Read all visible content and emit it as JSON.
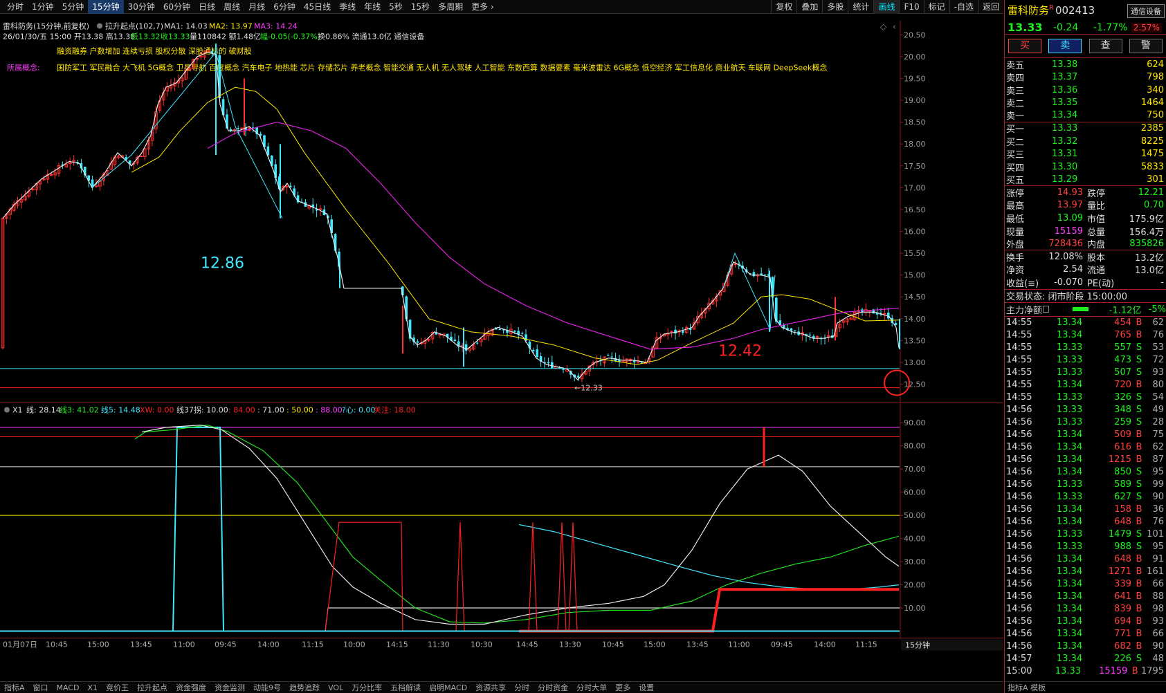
{
  "periods": [
    "分时",
    "1分钟",
    "5分钟",
    "15分钟",
    "30分钟",
    "60分钟",
    "日线",
    "周线",
    "月线",
    "6分钟",
    "45日线",
    "季线",
    "年线",
    "5秒",
    "15秒",
    "多周期",
    "更多 ›"
  ],
  "active_period": "15分钟",
  "tools": [
    "复权",
    "叠加",
    "多股",
    "统计",
    "画线",
    "F10",
    "标记",
    "-自选",
    "返回"
  ],
  "active_tool": "画线",
  "header": {
    "title": "雷科防务(15分钟,前复权)",
    "indicator": "拉升起点(102,7)",
    "ma1": "MA1: 14.03",
    "ma2": "MA2: 13.97",
    "ma3": "MA3: 14.24",
    "ohlc": "26/01/30/五 15:00 开13.38 高13.38",
    "low": "低13.32",
    "close": "收13.33",
    "vol": "量110842 额1.48亿",
    "amp": "幅-0.05(-0.37%)",
    "turn": "换0.86% 流通13.0亿 通信设备"
  },
  "tags": "融资融券  户数增加  连续亏损  股权分散  深股通标的  破财股",
  "concepts_label": "所属概念:",
  "concepts": "国防军工  军民融合  大飞机  5G概念  卫星导航  百度概念  汽车电子  地热能  芯片  存储芯片  养老概念  智能交通  无人机  无人驾驶  人工智能  东数西算  数据要素  毫米波雷达  6G概念  低空经济  军工信息化  商业航天  车联网  DeepSeek概念",
  "annotations": {
    "high_label": "12.86",
    "low_label": "12.42",
    "min_label": "←12.33"
  },
  "price_axis": [
    "20.50",
    "20.00",
    "19.50",
    "19.00",
    "18.50",
    "18.00",
    "17.50",
    "17.00",
    "16.50",
    "16.00",
    "15.50",
    "15.00",
    "14.50",
    "14.00",
    "13.50",
    "13.00",
    "12.50"
  ],
  "sub": {
    "name": "X1",
    "line": "线: 28.14",
    "l3": "线3: 41.02",
    "l5": "线5: 14.48",
    "xw": "XW: 0.00",
    "l37": "线37拐: 10.00",
    "v84": ": 84.00",
    "v71": ": 71.00",
    "v50": ": 50.00",
    "v88": ": 88.00",
    "heart": "?心: 0.00",
    "focus": "关注: 18.00",
    "axis": [
      "90.00",
      "80.00",
      "70.00",
      "60.00",
      "50.00",
      "40.00",
      "30.00",
      "20.00",
      "10.00"
    ]
  },
  "time_axis": [
    "01月07日",
    "10:45",
    "15:00",
    "13:45",
    "11:00",
    "09:45",
    "14:00",
    "11:15",
    "10:00",
    "14:15",
    "11:30",
    "10:30",
    "14:45",
    "13:30",
    "10:45",
    "15:00",
    "13:45",
    "11:00",
    "09:45",
    "14:00",
    "11:15"
  ],
  "period_badge": "15分钟",
  "bottom_tabs": [
    "指标A",
    "窗口",
    "MACD",
    "X1",
    "竞价王",
    "拉升起点",
    "资金强度",
    "资金监测",
    "动能9号",
    "趋势追踪",
    "VOL",
    "万分比率",
    "五档解读",
    "启明MACD",
    "资源共享",
    "分时",
    "分时资金",
    "分时大单",
    "更多",
    "设置"
  ],
  "quote": {
    "name": "雷科防务",
    "code": "002413",
    "flag": "R",
    "sector": "通信设备",
    "price": "13.33",
    "change": "-0.24",
    "pct": "-1.77%",
    "volratio": "2.57%",
    "buttons": [
      "买",
      "卖",
      "查",
      "警"
    ],
    "asks": [
      {
        "label": "卖五",
        "price": "13.38",
        "vol": "624"
      },
      {
        "label": "卖四",
        "price": "13.37",
        "vol": "798"
      },
      {
        "label": "卖三",
        "price": "13.36",
        "vol": "340"
      },
      {
        "label": "卖二",
        "price": "13.35",
        "vol": "1464"
      },
      {
        "label": "卖一",
        "price": "13.34",
        "vol": "750"
      }
    ],
    "bids": [
      {
        "label": "买一",
        "price": "13.33",
        "vol": "2385"
      },
      {
        "label": "买二",
        "price": "13.32",
        "vol": "8225"
      },
      {
        "label": "买三",
        "price": "13.31",
        "vol": "1475"
      },
      {
        "label": "买四",
        "price": "13.30",
        "vol": "5833"
      },
      {
        "label": "买五",
        "price": "13.29",
        "vol": "301"
      }
    ],
    "stats1": [
      {
        "k": "涨停",
        "v": "14.93",
        "vc": "red",
        "k2": "跌停",
        "v2": "12.21",
        "v2c": "green"
      },
      {
        "k": "最高",
        "v": "13.97",
        "vc": "red",
        "k2": "量比",
        "v2": "0.70",
        "v2c": "green"
      },
      {
        "k": "最低",
        "v": "13.09",
        "vc": "green",
        "k2": "市值",
        "v2": "175.9亿",
        "v2c": "white"
      },
      {
        "k": "现量",
        "v": "15159",
        "vc": "mag",
        "k2": "总量",
        "v2": "156.4万",
        "v2c": "white"
      },
      {
        "k": "外盘",
        "v": "728436",
        "vc": "red",
        "k2": "内盘",
        "v2": "835826",
        "v2c": "green"
      }
    ],
    "stats2": [
      {
        "k": "换手",
        "v": "12.08%",
        "vc": "white",
        "k2": "股本",
        "v2": "13.2亿",
        "v2c": "white"
      },
      {
        "k": "净资",
        "v": "2.54",
        "vc": "white",
        "k2": "流通",
        "v2": "13.0亿",
        "v2c": "white"
      },
      {
        "k": "收益(≡)",
        "v": "-0.070",
        "vc": "white",
        "k2": "PE(动)",
        "v2": "-",
        "v2c": "white"
      }
    ],
    "status": "交易状态: 闭市阶段 15:00:00",
    "mainflow_label": "主力净额",
    "mainflow_value": "-1.12亿",
    "mainflow_pct": "-5%",
    "ticks": [
      [
        "14:55",
        "13.34",
        "454",
        "B",
        "62"
      ],
      [
        "14:55",
        "13.34",
        "765",
        "B",
        "76"
      ],
      [
        "14:55",
        "13.33",
        "557",
        "S",
        "53"
      ],
      [
        "14:55",
        "13.33",
        "473",
        "S",
        "72"
      ],
      [
        "14:55",
        "13.33",
        "507",
        "S",
        "93"
      ],
      [
        "14:55",
        "13.34",
        "720",
        "B",
        "80"
      ],
      [
        "14:55",
        "13.33",
        "326",
        "S",
        "54"
      ],
      [
        "14:56",
        "13.33",
        "348",
        "S",
        "49"
      ],
      [
        "14:56",
        "13.33",
        "259",
        "S",
        "28"
      ],
      [
        "14:56",
        "13.34",
        "509",
        "B",
        "75"
      ],
      [
        "14:56",
        "13.34",
        "616",
        "B",
        "62"
      ],
      [
        "14:56",
        "13.34",
        "1215",
        "B",
        "87"
      ],
      [
        "14:56",
        "13.34",
        "850",
        "S",
        "95"
      ],
      [
        "14:56",
        "13.33",
        "589",
        "S",
        "99"
      ],
      [
        "14:56",
        "13.33",
        "627",
        "S",
        "90"
      ],
      [
        "14:56",
        "13.34",
        "158",
        "B",
        "36"
      ],
      [
        "14:56",
        "13.34",
        "648",
        "B",
        "76"
      ],
      [
        "14:56",
        "13.33",
        "1479",
        "S",
        "101"
      ],
      [
        "14:56",
        "13.33",
        "988",
        "S",
        "95"
      ],
      [
        "14:56",
        "13.34",
        "648",
        "B",
        "91"
      ],
      [
        "14:56",
        "13.34",
        "1271",
        "B",
        "161"
      ],
      [
        "14:56",
        "13.34",
        "339",
        "B",
        "66"
      ],
      [
        "14:56",
        "13.34",
        "641",
        "B",
        "88"
      ],
      [
        "14:56",
        "13.34",
        "839",
        "B",
        "98"
      ],
      [
        "14:56",
        "13.34",
        "694",
        "B",
        "93"
      ],
      [
        "14:56",
        "13.34",
        "771",
        "B",
        "66"
      ],
      [
        "14:56",
        "13.34",
        "682",
        "B",
        "90"
      ],
      [
        "14:57",
        "13.34",
        "226",
        "S",
        "48"
      ],
      [
        "15:00",
        "13.33",
        "15159",
        "B",
        "1795"
      ]
    ],
    "footer": "指标A  模板"
  }
}
